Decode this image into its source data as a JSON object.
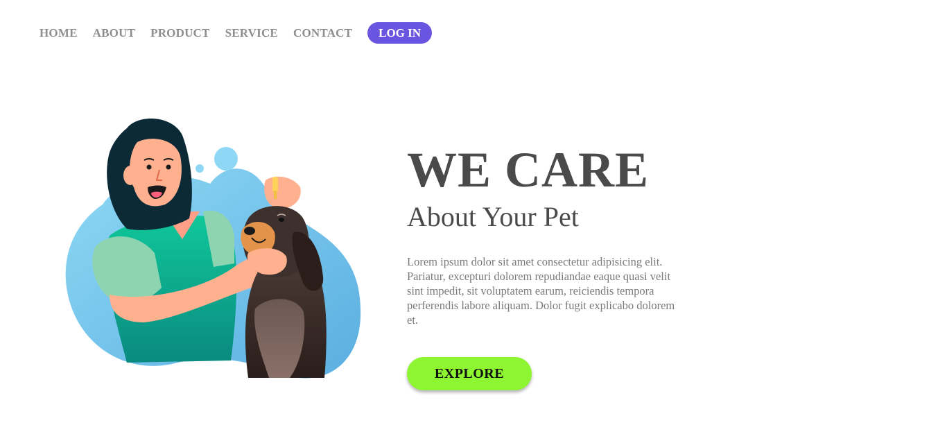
{
  "nav": {
    "items": [
      {
        "label": "HOME"
      },
      {
        "label": "ABOUT"
      },
      {
        "label": "PRODUCT"
      },
      {
        "label": "SERVICE"
      },
      {
        "label": "CONTACT"
      }
    ],
    "login_label": "LOG IN"
  },
  "hero": {
    "title": "WE CARE",
    "subtitle": "About Your Pet",
    "text": "Lorem ipsum dolor sit amet consectetur adipisicing elit. Pariatur, excepturi dolorem repudiandae eaque quasi velit sint impedit, sit voluptatem earum, reiciendis tempora perferendis labore aliquam. Dolor fugit explicabo dolorem et.",
    "button_label": "EXPLORE"
  },
  "colors": {
    "accent": "#6a55e0",
    "button": "#8ef533",
    "heading": "#4a4a4a",
    "nav_text": "#8e8e8e"
  },
  "illustration": {
    "icon": "woman-with-dog-illustration"
  }
}
